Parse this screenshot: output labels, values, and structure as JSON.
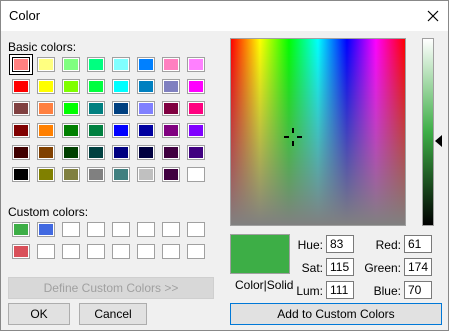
{
  "window": {
    "title": "Color"
  },
  "basic_colors": {
    "label": "Basic colors:",
    "selected": "#ff8080",
    "grid": [
      [
        "#ff8080",
        "#ffff80",
        "#80ff80",
        "#00ff80",
        "#80ffff",
        "#0080ff",
        "#ff80c0",
        "#ff80ff"
      ],
      [
        "#ff0000",
        "#ffff00",
        "#80ff00",
        "#00ff40",
        "#00ffff",
        "#0080c0",
        "#8080c0",
        "#ff00ff"
      ],
      [
        "#804040",
        "#ff8040",
        "#00ff00",
        "#008080",
        "#004080",
        "#8080ff",
        "#800040",
        "#ff0080"
      ],
      [
        "#800000",
        "#ff8000",
        "#008000",
        "#008040",
        "#0000ff",
        "#0000a0",
        "#800080",
        "#8000ff"
      ],
      [
        "#400000",
        "#804000",
        "#004000",
        "#004040",
        "#000080",
        "#000040",
        "#400040",
        "#400080"
      ],
      [
        "#000000",
        "#808000",
        "#808040",
        "#808080",
        "#408080",
        "#c0c0c0",
        "#400040",
        "#ffffff"
      ]
    ]
  },
  "custom_colors": {
    "label": "Custom colors:",
    "grid": [
      [
        "#3dae46",
        "#4169e1",
        "#ffffff",
        "#ffffff",
        "#ffffff",
        "#ffffff",
        "#ffffff",
        "#ffffff"
      ],
      [
        "#d9505a",
        "#ffffff",
        "#ffffff",
        "#ffffff",
        "#ffffff",
        "#ffffff",
        "#ffffff",
        "#ffffff"
      ]
    ]
  },
  "buttons": {
    "define_custom": "Define Custom Colors >>",
    "ok": "OK",
    "cancel": "Cancel",
    "add_custom": "Add to Custom Colors"
  },
  "preview": {
    "label": "Color|Solid",
    "color": "#3dae46"
  },
  "fields": {
    "hue_label": "Hue:",
    "hue": "83",
    "sat_label": "Sat:",
    "sat": "115",
    "lum_label": "Lum:",
    "lum": "111",
    "red_label": "Red:",
    "red": "61",
    "green_label": "Green:",
    "green": "174",
    "blue_label": "Blue:",
    "blue": "70"
  }
}
